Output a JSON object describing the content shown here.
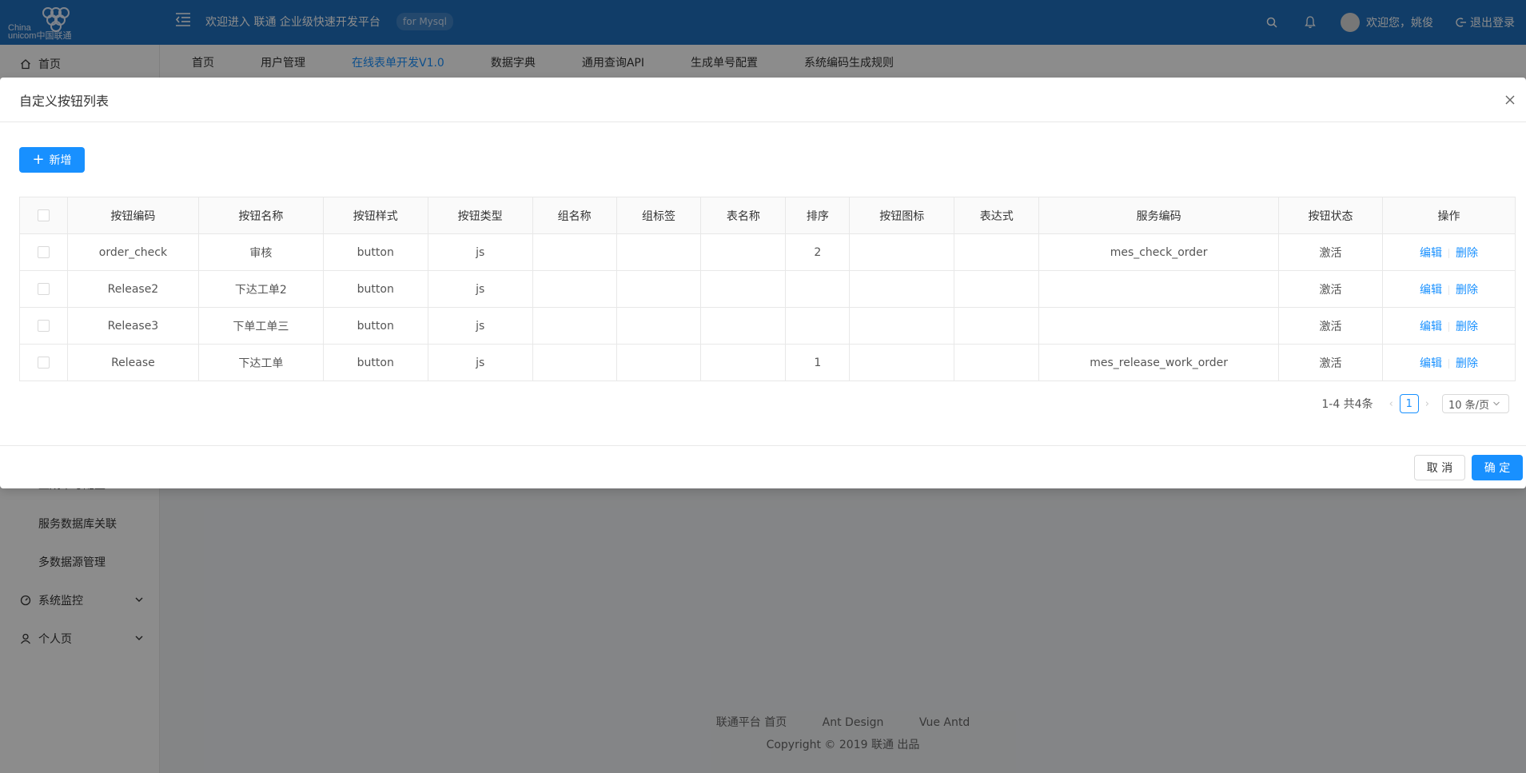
{
  "header": {
    "logo_text_line1": "China",
    "logo_text_line2": "unicom中国联通",
    "welcome": "欢迎进入 联通 企业级快速开发平台",
    "db_tag": "for Mysql",
    "user_greeting": "欢迎您，姚俊",
    "logout_label": "退出登录"
  },
  "sidebar": {
    "home": "首页",
    "partial_item": "生成单号配置",
    "item_service_db": "服务数据库关联",
    "item_multi_ds": "多数据源管理",
    "item_monitor": "系统监控",
    "item_profile": "个人页"
  },
  "tabs": [
    {
      "label": "首页",
      "active": false
    },
    {
      "label": "用户管理",
      "active": false
    },
    {
      "label": "在线表单开发V1.0",
      "active": true
    },
    {
      "label": "数据字典",
      "active": false
    },
    {
      "label": "通用查询API",
      "active": false
    },
    {
      "label": "生成单号配置",
      "active": false
    },
    {
      "label": "系统编码生成规则",
      "active": false
    }
  ],
  "footer": {
    "link1": "联通平台 首页",
    "link2": "Ant Design",
    "link3": "Vue Antd",
    "copyright": "Copyright © 2019 联通 出品"
  },
  "modal": {
    "title": "自定义按钮列表",
    "add_label": "新增",
    "columns": [
      "按钮编码",
      "按钮名称",
      "按钮样式",
      "按钮类型",
      "组名称",
      "组标签",
      "表名称",
      "排序",
      "按钮图标",
      "表达式",
      "服务编码",
      "按钮状态",
      "操作"
    ],
    "rows": [
      [
        "order_check",
        "审核",
        "button",
        "js",
        "",
        "",
        "",
        "2",
        "",
        "",
        "mes_check_order",
        "激活"
      ],
      [
        "Release2",
        "下达工单2",
        "button",
        "js",
        "",
        "",
        "",
        "",
        "",
        "",
        "",
        "激活"
      ],
      [
        "Release3",
        "下单工单三",
        "button",
        "js",
        "",
        "",
        "",
        "",
        "",
        "",
        "",
        "激活"
      ],
      [
        "Release",
        "下达工单",
        "button",
        "js",
        "",
        "",
        "",
        "1",
        "",
        "",
        "mes_release_work_order",
        "激活"
      ]
    ],
    "edit_label": "编辑",
    "delete_label": "删除",
    "pagination": {
      "total_text": "1-4 共4条",
      "current_page": "1",
      "page_size": "10 条/页"
    },
    "cancel_label": "取 消",
    "ok_label": "确 定"
  },
  "colors": {
    "header_bg": "#1f6fbe",
    "primary": "#1890ff"
  }
}
